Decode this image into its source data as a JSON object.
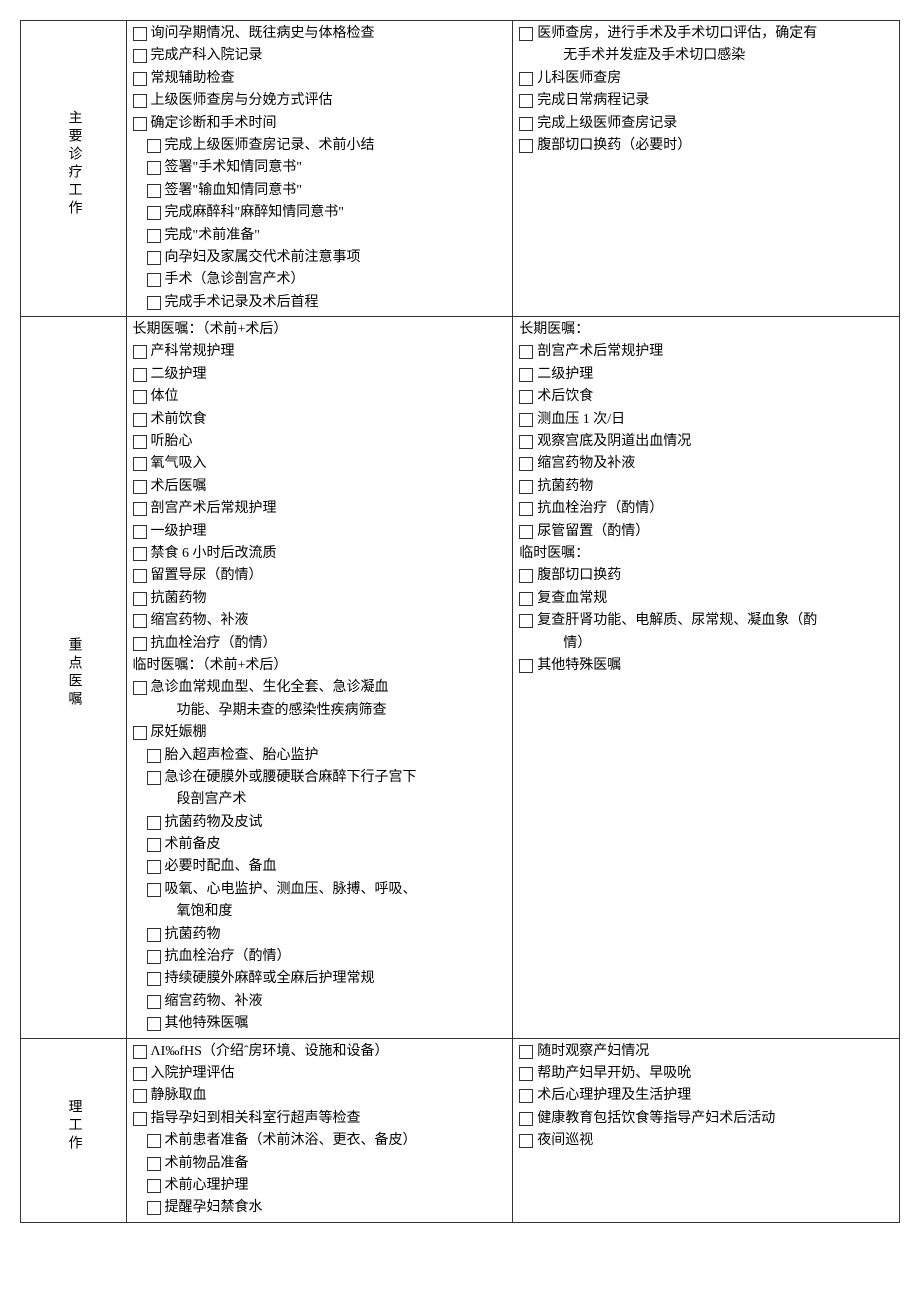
{
  "rows": [
    {
      "label": "主要诊疗工作",
      "left": [
        {
          "c": "询问孕期情况、既往病史与体格检查",
          "box": true
        },
        {
          "c": "完成产科入院记录",
          "box": true
        },
        {
          "c": "常规辅助检查",
          "box": true
        },
        {
          "c": "上级医师查房与分娩方式评估",
          "box": true
        },
        {
          "c": "确定诊断和手术时间",
          "box": true
        },
        {
          "c": "完成上级医师查房记录、术前小结",
          "box": true,
          "sp": true
        },
        {
          "c": "签署\"手术知情同意书\"",
          "box": true,
          "sp": true
        },
        {
          "c": "签署\"输血知情同意书\"",
          "box": true,
          "sp": true
        },
        {
          "c": "完成麻醉科\"麻醉知情同意书\"",
          "box": true,
          "sp": true
        },
        {
          "c": "完成\"术前准备\"",
          "box": true,
          "sp": true
        },
        {
          "c": "向孕妇及家属交代术前注意事项",
          "box": true,
          "sp": true
        },
        {
          "c": "手术（急诊剖宫产术）",
          "box": true,
          "sp": true
        },
        {
          "c": "完成手术记录及术后首程",
          "box": true,
          "sp": true
        }
      ],
      "right": [
        {
          "c": "医师查房，进行手术及手术切口评估，确定有",
          "box": true
        },
        {
          "c": "无手术并发症及手术切口感染",
          "indent": true
        },
        {
          "c": "儿科医师查房",
          "box": true
        },
        {
          "c": "完成日常病程记录",
          "box": true
        },
        {
          "c": "完成上级医师查房记录",
          "box": true
        },
        {
          "c": "腹部切口换药（必要时）",
          "box": true
        }
      ]
    },
    {
      "label": "重点医嘱",
      "left": [
        {
          "c": "长期医嘱：（术前+术后）",
          "plain": true
        },
        {
          "c": "产科常规护理",
          "box": true
        },
        {
          "c": "二级护理",
          "box": true
        },
        {
          "c": "体位",
          "box": true
        },
        {
          "c": "术前饮食",
          "box": true
        },
        {
          "c": "听胎心",
          "box": true
        },
        {
          "c": "氧气吸入",
          "box": true
        },
        {
          "c": "术后医嘱",
          "box": true
        },
        {
          "c": "剖宫产术后常规护理",
          "box": true
        },
        {
          "c": "一级护理",
          "box": true
        },
        {
          "c": "禁食 6 小时后改流质",
          "box": true
        },
        {
          "c": "留置导尿（酌情）",
          "box": true
        },
        {
          "c": "抗菌药物",
          "box": true
        },
        {
          "c": "缩宫药物、补液",
          "box": true
        },
        {
          "c": "抗血栓治疗（酌情）",
          "box": true
        },
        {
          "c": "临时医嘱：（术前+术后）",
          "plain": true
        },
        {
          "c": "急诊血常规血型、生化全套、急诊凝血",
          "box": true
        },
        {
          "c": "功能、孕期未查的感染性疾病筛查",
          "indent": true
        },
        {
          "c": "尿妊娠棚",
          "box": true
        },
        {
          "c": "胎入超声检查、胎心监护",
          "box": true,
          "sp": true
        },
        {
          "c": "急诊在硬膜外或腰硬联合麻醉下行子宫下",
          "box": true,
          "sp": true
        },
        {
          "c": "段剖宫产术",
          "indent": true
        },
        {
          "c": "抗菌药物及皮试",
          "box": true,
          "sp": true
        },
        {
          "c": "术前备皮",
          "box": true,
          "sp": true
        },
        {
          "c": "必要时配血、备血",
          "box": true,
          "sp": true
        },
        {
          "c": "吸氧、心电监护、测血压、脉搏、呼吸、",
          "box": true,
          "sp": true
        },
        {
          "c": "氧饱和度",
          "indent": true
        },
        {
          "c": "抗菌药物",
          "box": true,
          "sp": true
        },
        {
          "c": "抗血栓治疗（酌情）",
          "box": true,
          "sp": true
        },
        {
          "c": "持续硬膜外麻醉或全麻后护理常规",
          "box": true,
          "sp": true
        },
        {
          "c": "缩宫药物、补液",
          "box": true,
          "sp": true
        },
        {
          "c": "其他特殊医嘱",
          "box": true,
          "sp": true
        }
      ],
      "right": [
        {
          "c": "长期医嘱：",
          "plain": true
        },
        {
          "c": "剖宫产术后常规护理",
          "box": true
        },
        {
          "c": "二级护理",
          "box": true
        },
        {
          "c": "术后饮食",
          "box": true
        },
        {
          "c": "测血压 1 次/日",
          "box": true
        },
        {
          "c": "观察宫底及阴道出血情况",
          "box": true
        },
        {
          "c": "缩宫药物及补液",
          "box": true
        },
        {
          "c": "抗菌药物",
          "box": true
        },
        {
          "c": "抗血栓治疗（酌情）",
          "box": true
        },
        {
          "c": "尿管留置（酌情）",
          "box": true
        },
        {
          "c": "临时医嘱：",
          "plain": true
        },
        {
          "c": "腹部切口换药",
          "box": true
        },
        {
          "c": "复查血常规",
          "box": true
        },
        {
          "c": "复查肝肾功能、电解质、尿常规、凝血象（酌",
          "box": true
        },
        {
          "c": "情）",
          "indent": true
        },
        {
          "c": "其他特殊医嘱",
          "box": true
        }
      ]
    },
    {
      "label": "理工作",
      "left": [
        {
          "c": "ΛI‰fHS（介绍ˆ房环境、设施和设备）",
          "box": true
        },
        {
          "c": "入院护理评估",
          "box": true
        },
        {
          "c": "静脉取血",
          "box": true
        },
        {
          "c": "指导孕妇到相关科室行超声等检查",
          "box": true
        },
        {
          "c": "术前患者准备（术前沐浴、更衣、备皮）",
          "box": true,
          "sp": true
        },
        {
          "c": "术前物品准备",
          "box": true,
          "sp": true
        },
        {
          "c": "术前心理护理",
          "box": true,
          "sp": true
        },
        {
          "c": "提醒孕妇禁食水",
          "box": true,
          "sp": true
        }
      ],
      "right": [
        {
          "c": "随时观察产妇情况",
          "box": true
        },
        {
          "c": "帮助产妇早开奶、早吸吮",
          "box": true
        },
        {
          "c": "术后心理护理及生活护理",
          "box": true
        },
        {
          "c": "健康教育包括饮食等指导产妇术后活动",
          "box": true
        },
        {
          "c": "夜间巡视",
          "box": true
        }
      ]
    }
  ]
}
